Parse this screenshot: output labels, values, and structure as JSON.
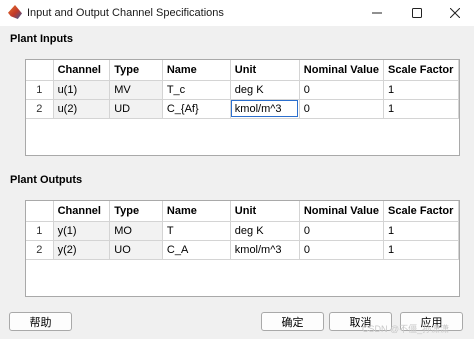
{
  "window": {
    "title": "Input and Output Channel Specifications",
    "minimize_icon": "minimize-icon",
    "maximize_icon": "maximize-icon",
    "close_icon": "close-icon"
  },
  "inputs": {
    "section_label": "Plant Inputs",
    "columns": [
      "Channel",
      "Type",
      "Name",
      "Unit",
      "Nominal Value",
      "Scale Factor"
    ],
    "rows": [
      {
        "num": "1",
        "channel": "u(1)",
        "type": "MV",
        "name": "T_c",
        "unit": "deg K",
        "nominal": "0",
        "scale": "1"
      },
      {
        "num": "2",
        "channel": "u(2)",
        "type": "UD",
        "name": "C_{Af}",
        "unit": "kmol/m^3",
        "nominal": "0",
        "scale": "1"
      }
    ]
  },
  "outputs": {
    "section_label": "Plant Outputs",
    "columns": [
      "Channel",
      "Type",
      "Name",
      "Unit",
      "Nominal Value",
      "Scale Factor"
    ],
    "rows": [
      {
        "num": "1",
        "channel": "y(1)",
        "type": "MO",
        "name": "T",
        "unit": "deg K",
        "nominal": "0",
        "scale": "1"
      },
      {
        "num": "2",
        "channel": "y(2)",
        "type": "UO",
        "name": "C_A",
        "unit": "kmol/m^3",
        "nominal": "0",
        "scale": "1"
      }
    ]
  },
  "buttons": {
    "help": "帮助",
    "ok": "确定",
    "cancel": "取消",
    "apply": "应用"
  },
  "watermark": "CSDN @不僵_孙潇潇"
}
